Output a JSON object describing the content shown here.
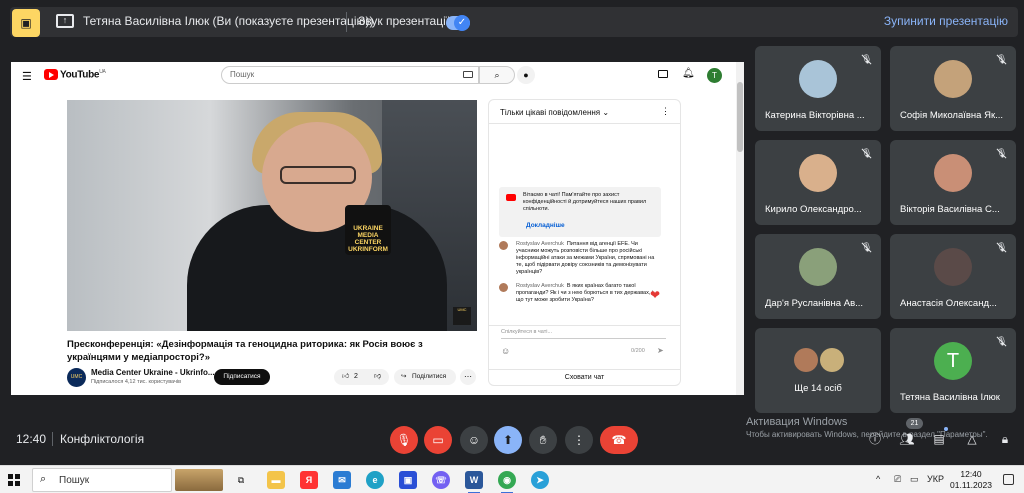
{
  "presentation_bar": {
    "presenter_text": "Тетяна Василівна Ілюк (Ви (показуєте презентацію))",
    "audio_label": "Звук презентації",
    "audio_on": true,
    "stop_label": "Зупинити презентацію"
  },
  "youtube": {
    "logo_text": "YouTube",
    "logo_region": "UA",
    "search_placeholder": "Пошук",
    "avatar_letter": "T",
    "video": {
      "mic_label": "UKRAINE MEDIA CENTER UKRINFORM",
      "title": "Пресконференція: «Дезінформація та геноцидна риторика: як Росія воює з українцями у медіапросторі?»",
      "channel_name": "Media Center Ukraine - Ukrinfo...",
      "subscribers": "Підписалося 4,12 тис. користувачів",
      "subscribe_label": "Підписатися",
      "likes": "2",
      "share_label": "Поділитися"
    },
    "chat": {
      "mode_label": "Тільки цікаві повідомлення",
      "welcome_text": "Вітаємо в чаті! Пам'ятайте про захист конфіденційності й дотримуйтеся наших правил спільноти.",
      "welcome_more": "Докладніше",
      "messages": [
        {
          "author": "Rostyslav Averchuk",
          "text": "Питання від агенції EFE. Чи учасники можуть розповісти більше про російські інформаційні атаки за межами України, спрямовані на те, щоб підірвати довіру союзників та демонізувати українців?"
        },
        {
          "author": "Rostyslav Averchuk",
          "text": "В яких країнах багато такої пропаганди? Як і чи з нею борються в тих державах, і що тут може зробити Україна?"
        }
      ],
      "input_placeholder": "Спілкуйтеся в чаті...",
      "char_count": "0/200",
      "hide_label": "Сховати чат"
    }
  },
  "participants": [
    {
      "name": "Катерина Вікторівна ...",
      "type": "photo",
      "color": "#a9c4d8"
    },
    {
      "name": "Софія Миколаївна Як...",
      "type": "photo",
      "color": "#c4a27a"
    },
    {
      "name": "Кирило Олександро...",
      "type": "photo",
      "color": "#d9b08c"
    },
    {
      "name": "Вікторія Василівна С...",
      "type": "photo",
      "color": "#c98f76"
    },
    {
      "name": "Дар'я Русланівна Ав...",
      "type": "photo",
      "color": "#8aa07a"
    },
    {
      "name": "Анастасія Олександ...",
      "type": "photo",
      "color": "#5a4a48"
    },
    {
      "name": "Ще 14 осіб",
      "type": "group"
    },
    {
      "name": "Тетяна Василівна Ілюк",
      "type": "letter",
      "letter": "T"
    }
  ],
  "meeting": {
    "time": "12:40",
    "title": "Конфліктологія",
    "participant_count": "21"
  },
  "watermark": {
    "line1": "Активация Windows",
    "line2": "Чтобы активировать Windows, перейдите в раздел \"Параметры\"."
  },
  "taskbar": {
    "search_label": "Пошук",
    "language": "УКР",
    "time": "12:40",
    "date": "01.11.2023"
  },
  "colors": {
    "meet_bg": "#202124",
    "accent": "#8ab4f8",
    "danger": "#ea4335",
    "yt_red": "#ff0000"
  }
}
